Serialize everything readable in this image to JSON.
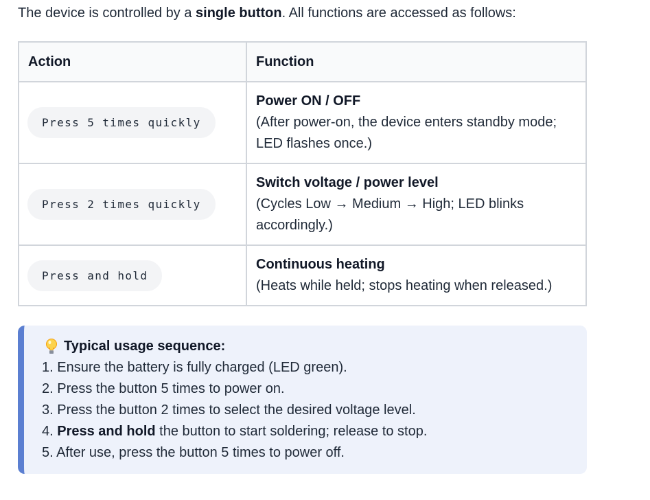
{
  "intro": {
    "prefix": "The device is controlled by a ",
    "bold": "single button",
    "suffix": ". All functions are accessed as follows:"
  },
  "table": {
    "headers": [
      "Action",
      "Function"
    ],
    "rows": [
      {
        "action": "Press 5 times quickly",
        "function_title": "Power ON / OFF",
        "function_desc": "(After power-on, the device enters standby mode; LED flashes once.)"
      },
      {
        "action": "Press 2 times quickly",
        "function_title": "Switch voltage / power level",
        "function_desc": "(Cycles Low → Medium → High; LED blinks accordingly.)"
      },
      {
        "action": "Press and hold",
        "function_title": "Continuous heating",
        "function_desc": "(Heats while held; stops heating when released.)"
      }
    ]
  },
  "tip": {
    "icon": "lightbulb-icon",
    "title": "Typical usage sequence:",
    "steps": [
      "1. Ensure the battery is fully charged (LED green).",
      "2. Press the button 5 times to power on.",
      "3. Press the button 2 times to select the desired voltage level.",
      "4. ",
      "5. After use, press the button 5 times to power off."
    ],
    "step4_bold": "Press and hold",
    "step4_rest": " the button to start soldering; release to stop.",
    "accent_color": "#5b7fd1",
    "background_color": "#eef2fb"
  }
}
